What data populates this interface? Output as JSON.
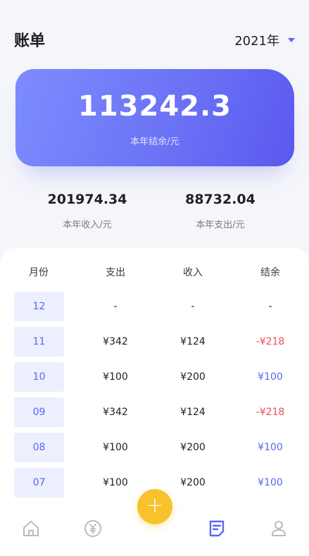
{
  "header": {
    "title": "账单",
    "year": "2021年"
  },
  "summary": {
    "balance": "113242.3",
    "balance_label": "本年结余/元",
    "income": "201974.34",
    "income_label": "本年收入/元",
    "expense": "88732.04",
    "expense_label": "本年支出/元"
  },
  "table": {
    "headers": [
      "月份",
      "支出",
      "收入",
      "结余"
    ],
    "rows": [
      {
        "month": "12",
        "expense": "-",
        "income": "-",
        "balance": "-"
      },
      {
        "month": "11",
        "expense": "¥342",
        "income": "¥124",
        "balance": "-¥218"
      },
      {
        "month": "10",
        "expense": "¥100",
        "income": "¥200",
        "balance": "¥100"
      },
      {
        "month": "09",
        "expense": "¥342",
        "income": "¥124",
        "balance": "-¥218"
      },
      {
        "month": "08",
        "expense": "¥100",
        "income": "¥200",
        "balance": "¥100"
      },
      {
        "month": "07",
        "expense": "¥100",
        "income": "¥200",
        "balance": "¥100"
      }
    ]
  },
  "fab": {
    "label": "+"
  },
  "tabbar": {
    "items": [
      {
        "icon": "home-icon",
        "active": false
      },
      {
        "icon": "yen-circle-icon",
        "active": false
      },
      {
        "icon": "bill-icon",
        "active": true
      },
      {
        "icon": "user-icon",
        "active": false
      }
    ]
  },
  "colors": {
    "accent": "#5b66f0",
    "negative": "#f04f4f",
    "fab": "#f8c22c",
    "card_gradient_start": "#7d8cff",
    "card_gradient_end": "#5a58f0"
  }
}
